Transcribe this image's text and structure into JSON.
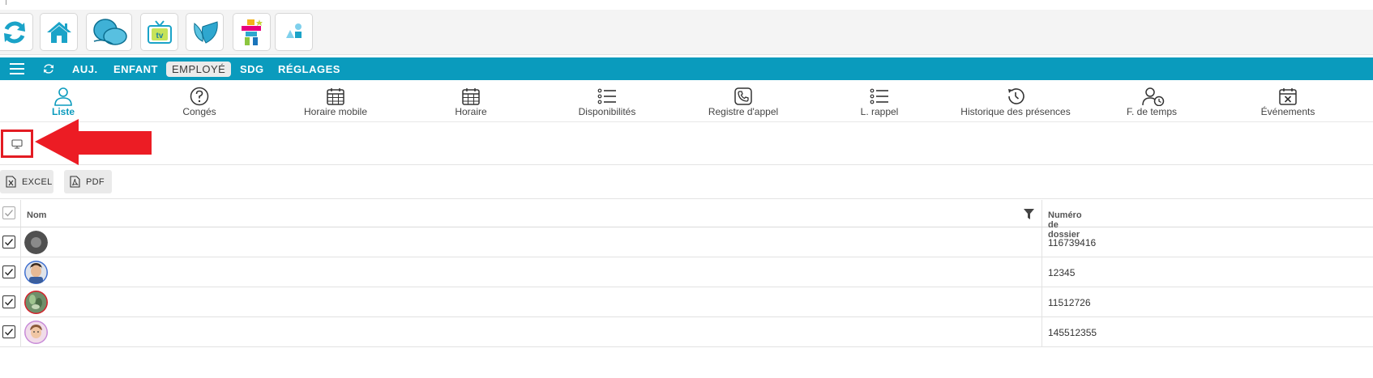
{
  "app_bar": {
    "icons": [
      "refresh-icon",
      "home-icon",
      "blue-logo-icon",
      "tv-icon",
      "butterfly-icon",
      "inukshuk-icon",
      "shapes-icon"
    ]
  },
  "nav": {
    "tabs": [
      {
        "label": "AUJ.",
        "active": false
      },
      {
        "label": "ENFANT",
        "active": false
      },
      {
        "label": "EMPLOYÉ",
        "active": true
      },
      {
        "label": "SDG",
        "active": false
      },
      {
        "label": "RÉGLAGES",
        "active": false
      }
    ],
    "color": "#0a9bbd"
  },
  "subnav": {
    "items": [
      {
        "label": "Liste",
        "icon": "person-icon",
        "active": true
      },
      {
        "label": "Congés",
        "icon": "question-icon",
        "active": false
      },
      {
        "label": "Horaire mobile",
        "icon": "calendar-icon",
        "active": false
      },
      {
        "label": "Horaire",
        "icon": "calendar-icon",
        "active": false
      },
      {
        "label": "Disponibilités",
        "icon": "list-icon",
        "active": false
      },
      {
        "label": "Registre d'appel",
        "icon": "phone-icon",
        "active": false
      },
      {
        "label": "L. rappel",
        "icon": "list-icon",
        "active": false
      },
      {
        "label": "Historique des présences",
        "icon": "history-icon",
        "active": false
      },
      {
        "label": "F. de temps",
        "icon": "person-clock-icon",
        "active": false
      },
      {
        "label": "Événements",
        "icon": "calendar-x-icon",
        "active": false
      }
    ]
  },
  "toolbar": {
    "view_icon": "monitor-icon",
    "highlight_color": "#e31b23",
    "excel_label": "EXCEL",
    "pdf_label": "PDF"
  },
  "table": {
    "columns": [
      "Nom",
      "Numéro de dossier"
    ],
    "rows": [
      {
        "checked": true,
        "avatar": "gray-circle-avatar",
        "name": "",
        "dossier": "116739416"
      },
      {
        "checked": true,
        "avatar": "man-photo-avatar",
        "name": "",
        "dossier": "12345"
      },
      {
        "checked": true,
        "avatar": "plant-photo-avatar",
        "name": "",
        "dossier": "11512726"
      },
      {
        "checked": true,
        "avatar": "child-photo-avatar",
        "name": "",
        "dossier": "145512355"
      }
    ]
  }
}
